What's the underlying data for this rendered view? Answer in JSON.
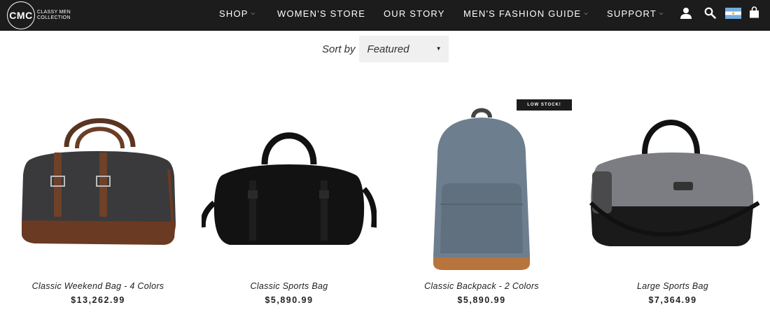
{
  "brand": {
    "mark": "CMC",
    "name_line1": "CLASSY MEN",
    "name_line2": "COLLECTION"
  },
  "nav": {
    "items": [
      {
        "label": "SHOP",
        "has_dropdown": true
      },
      {
        "label": "WOMEN'S STORE",
        "has_dropdown": false
      },
      {
        "label": "OUR STORY",
        "has_dropdown": false
      },
      {
        "label": "MEN'S FASHION GUIDE",
        "has_dropdown": true
      },
      {
        "label": "SUPPORT",
        "has_dropdown": true
      }
    ],
    "icons": [
      "account-icon",
      "search-icon",
      "argentina-flag-icon",
      "cart-icon"
    ]
  },
  "sort": {
    "label": "Sort by",
    "selected": "Featured"
  },
  "products": [
    {
      "title": "Classic Weekend Bag - 4 Colors",
      "price": "$13,262.99",
      "badge": ""
    },
    {
      "title": "Classic Sports Bag",
      "price": "$5,890.99",
      "badge": ""
    },
    {
      "title": "Classic Backpack - 2 Colors",
      "price": "$5,890.99",
      "badge": "LOW STOCK!"
    },
    {
      "title": "Large Sports Bag",
      "price": "$7,364.99",
      "badge": ""
    }
  ],
  "colors": {
    "nav_bg": "#1c1c1c",
    "sort_bg": "#f0f0f0"
  }
}
